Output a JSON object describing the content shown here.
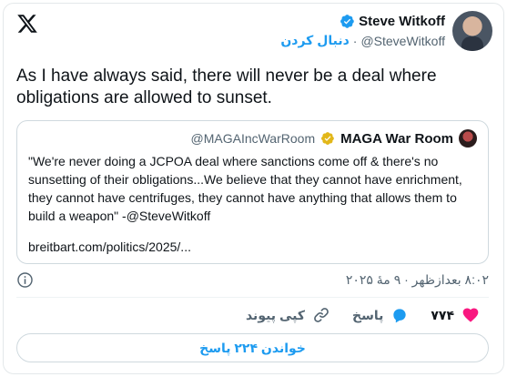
{
  "author": {
    "display_name": "Steve Witkoff",
    "handle": "@SteveWitkoff",
    "follow_label": "دنبال کردن",
    "separator": "·"
  },
  "tweet": {
    "text": "As I have always said, there will never be a deal where obligations are allowed to sunset."
  },
  "quote": {
    "handle": "@MAGAIncWarRoom",
    "display_name": "MAGA War Room",
    "text": "\"We're never doing a JCPOA deal where sanctions come off & there's no sunsetting of their obligations...We believe that they cannot have enrichment, they cannot have centrifuges, they cannot have anything that allows them to build a weapon\" -@SteveWitkoff",
    "link": "breitbart.com/politics/2025/..."
  },
  "meta": {
    "timestamp": "۸:۰۲ بعدازظهر · ۹ مهٔ ۲۰۲۵"
  },
  "actions": {
    "like_count": "۷۷۴",
    "reply_label": "پاسخ",
    "copy_link_label": "کپی پیوند"
  },
  "read_replies_label": "خواندن ۲۲۴ پاسخ",
  "colors": {
    "accent": "#1d9bf0",
    "like": "#f91880",
    "gold_badge": "#e2b719",
    "text_primary": "#0f1419",
    "text_secondary": "#536471"
  },
  "icons": [
    "x-logo-icon",
    "verified-badge-icon",
    "gold-verified-badge-icon",
    "info-icon",
    "heart-icon",
    "reply-icon",
    "link-icon"
  ]
}
